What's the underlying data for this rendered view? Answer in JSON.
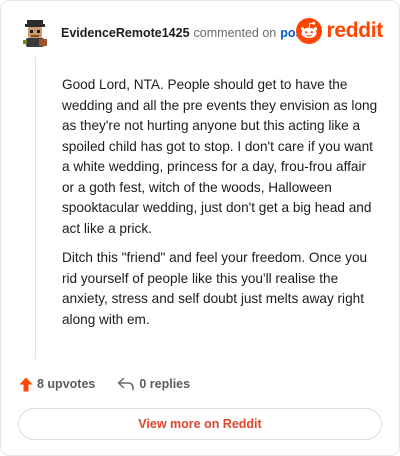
{
  "header": {
    "username": "EvidenceRemote1425",
    "commented_text": "commented on",
    "post_link": "post",
    "brand": "reddit"
  },
  "comment": {
    "paragraphs": [
      "Good Lord, NTA. People should get to have the wedding and all the pre events they envision as long as they're not hurting anyone but this acting like a spoiled child has got to stop. I don't care if you want a white wedding, princess for a day, frou-frou affair or a goth fest, witch of the woods, Halloween spooktacular wedding, just don't get a big head and act like a prick.",
      "Ditch this \"friend\" and feel your freedom. Once you rid yourself of people like this you'll realise the anxiety, stress and self doubt just melts away right along with em."
    ]
  },
  "actions": {
    "upvotes_label": "8 upvotes",
    "replies_label": "0 replies"
  },
  "footer": {
    "view_more_label": "View more on Reddit"
  },
  "colors": {
    "brand": "#ff4500",
    "link": "#0a58ca",
    "button_text": "#e0442b"
  },
  "icons": {
    "avatar": "user-avatar",
    "logo": "reddit-snoo-icon",
    "upvote": "upvote-arrow-icon",
    "reply": "reply-arrow-icon"
  }
}
